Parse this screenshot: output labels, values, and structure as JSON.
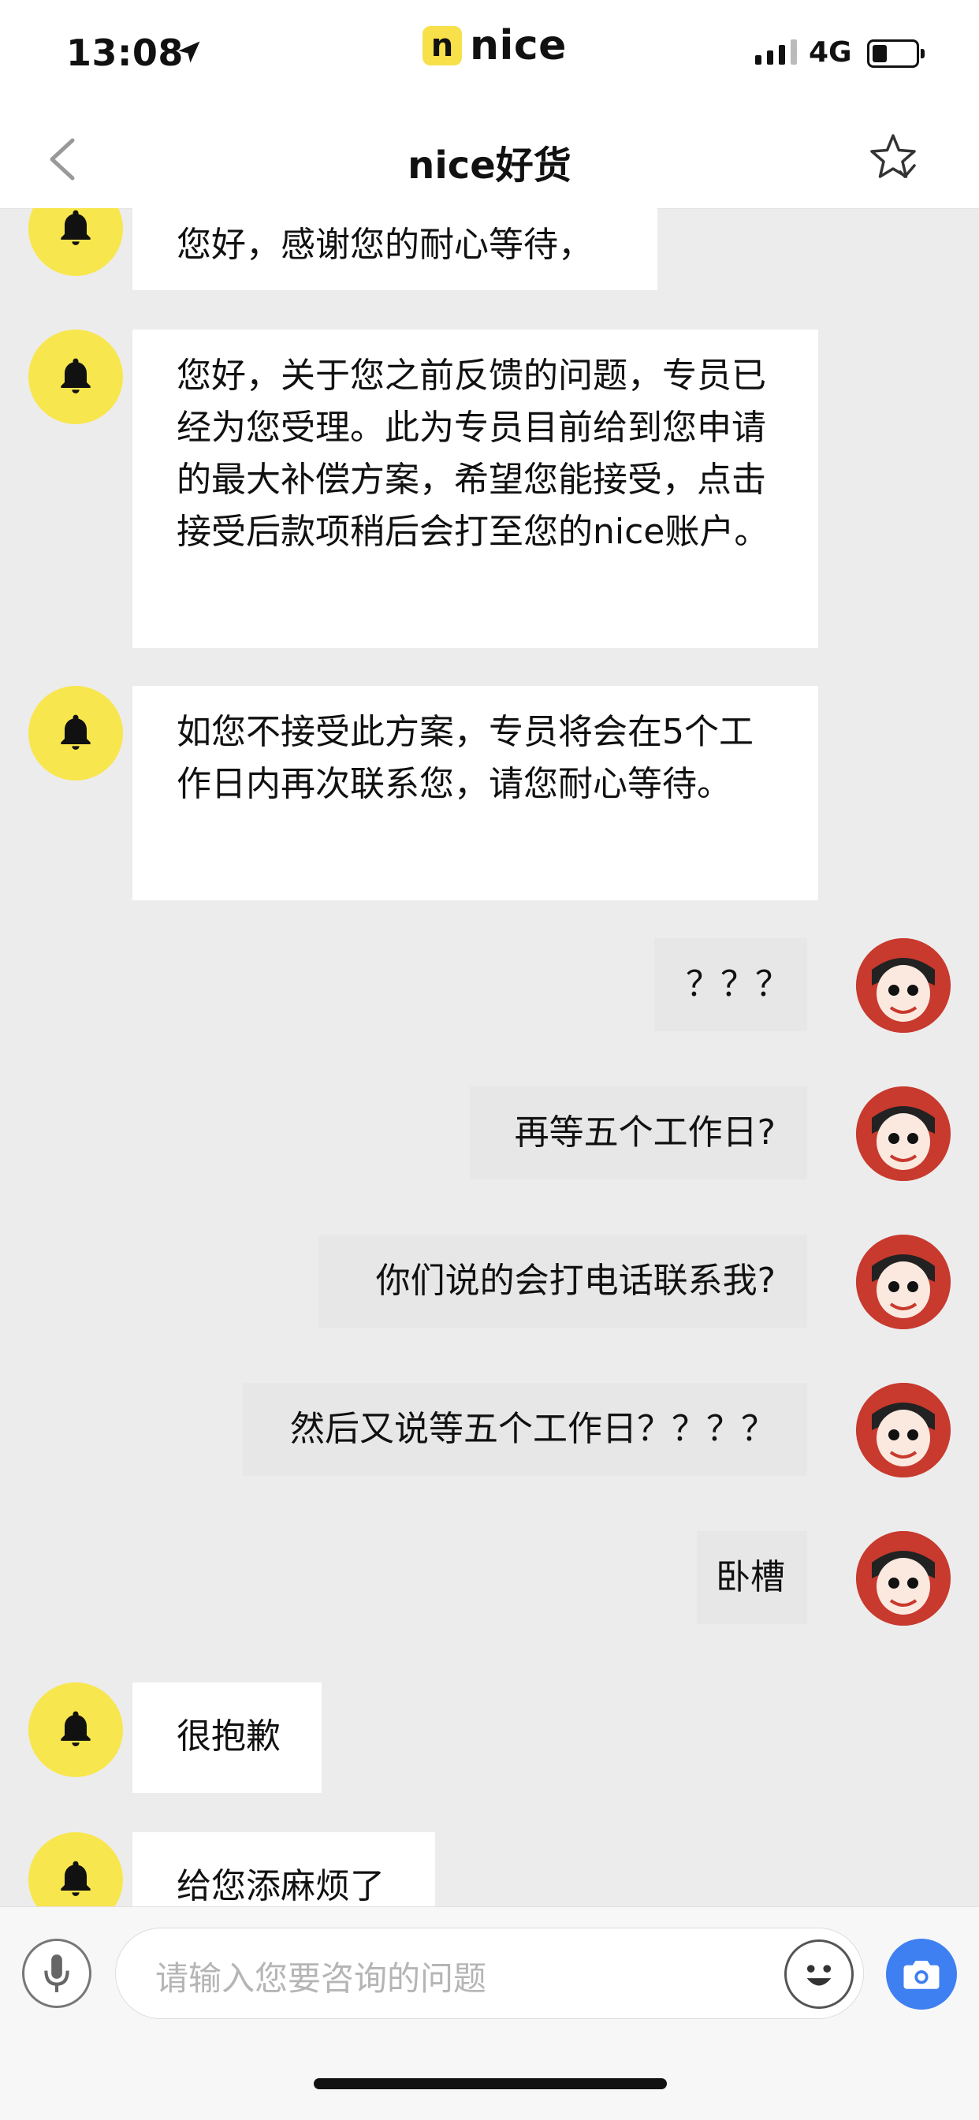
{
  "status_bar": {
    "time": "13:08",
    "brand_badge": "n",
    "brand_name": "nice",
    "network": "4G"
  },
  "nav": {
    "title": "nice好货"
  },
  "messages": [
    {
      "sender": "service",
      "text": "您好，感谢您的耐心等待，"
    },
    {
      "sender": "service",
      "text": "您好，关于您之前反馈的问题，专员已经为您受理。此为专员目前给到您申请的最大补偿方案，希望您能接受，点击接受后款项稍后会打至您的nice账户。"
    },
    {
      "sender": "service",
      "text": "如您不接受此方案，专员将会在5个工作日内再次联系您，请您耐心等待。"
    },
    {
      "sender": "user",
      "text": "？？？"
    },
    {
      "sender": "user",
      "text": "再等五个工作日?"
    },
    {
      "sender": "user",
      "text": "你们说的会打电话联系我?"
    },
    {
      "sender": "user",
      "text": "然后又说等五个工作日？？？？"
    },
    {
      "sender": "user",
      "text": "卧槽"
    },
    {
      "sender": "service",
      "text": "很抱歉"
    },
    {
      "sender": "service",
      "text": "给您添麻烦了"
    }
  ],
  "input": {
    "placeholder": "请输入您要咨询的问题"
  },
  "icons": {
    "back": "chevron-left-icon",
    "favorite": "star-icon",
    "service_avatar": "bell-icon",
    "voice": "microphone-icon",
    "emoji": "emoji-icon",
    "photo": "camera-icon"
  },
  "colors": {
    "accent_yellow": "#f8e64e",
    "camera_blue": "#3e7ff1",
    "chat_background": "#ececec"
  }
}
